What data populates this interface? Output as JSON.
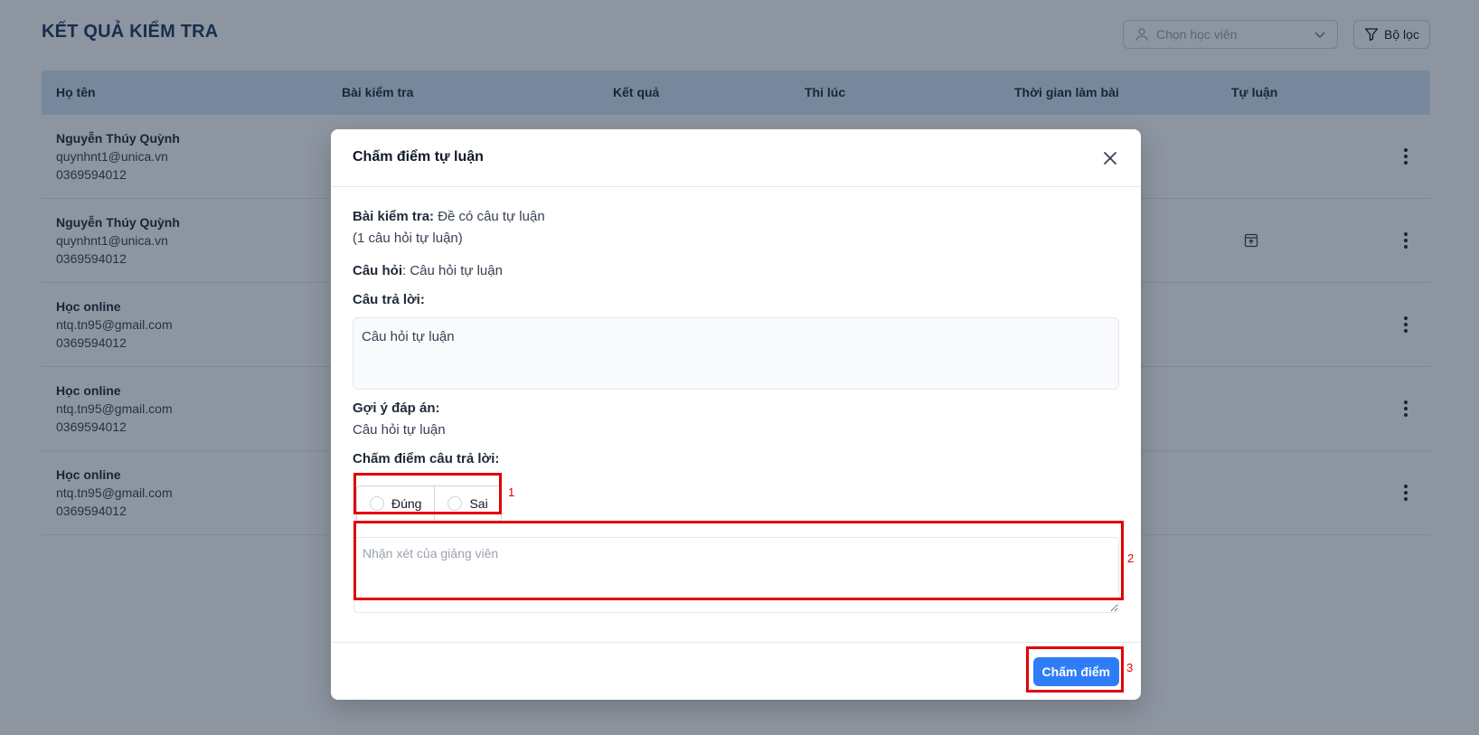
{
  "page": {
    "title": "KẾT QUẢ KIỂM TRA",
    "student_select_placeholder": "Chọn học viên",
    "filter_label": "Bộ lọc"
  },
  "table": {
    "headers": [
      "Họ tên",
      "Bài kiểm tra",
      "Kết quả",
      "Thi lúc",
      "Thời gian làm bài",
      "Tự luận"
    ],
    "rows": [
      {
        "name": "Nguyễn Thúy Quỳnh",
        "email": "quynhnt1@unica.vn",
        "phone": "0369594012"
      },
      {
        "name": "Nguyễn Thúy Quỳnh",
        "email": "quynhnt1@unica.vn",
        "phone": "0369594012"
      },
      {
        "name": "Học online",
        "email": "ntq.tn95@gmail.com",
        "phone": "0369594012"
      },
      {
        "name": "Học online",
        "email": "ntq.tn95@gmail.com",
        "phone": "0369594012"
      },
      {
        "name": "Học online",
        "email": "ntq.tn95@gmail.com",
        "phone": "0369594012"
      }
    ]
  },
  "modal": {
    "title": "Chấm điểm tự luận",
    "exam_label": "Bài kiểm tra:",
    "exam_value": "Đề có câu tự luận",
    "exam_count": "(1 câu hỏi tự luận)",
    "question_label": "Câu hỏi",
    "question_value": ": Câu hỏi tự luận",
    "answer_label": "Câu trả lời:",
    "answer_value": "Câu hỏi tự luận",
    "hint_label": "Gợi ý đáp án:",
    "hint_value": "Câu hỏi tự luận",
    "grade_label": "Chấm điểm câu trả lời:",
    "options": [
      "Đúng",
      "Sai"
    ],
    "comment_placeholder": "Nhận xét của giảng viên",
    "comment_value": "",
    "submit_label": "Chấm điểm"
  },
  "annotations": [
    "1",
    "2",
    "3"
  ],
  "colors": {
    "primary": "#2f7df6",
    "annotation": "#e00000",
    "header_bg": "#d6e6f5"
  }
}
